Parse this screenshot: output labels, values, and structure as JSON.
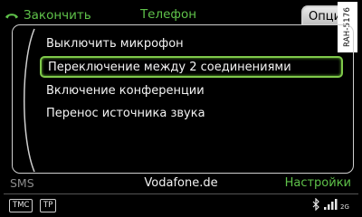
{
  "header": {
    "back_label": "Закончить",
    "title": "Телефон",
    "options_tab": "Опции"
  },
  "watermark": "RAH-5176",
  "menu": {
    "items": [
      {
        "label": "Выключить микрофон",
        "selected": false
      },
      {
        "label": "Переключение между 2 соединениями",
        "selected": true
      },
      {
        "label": "Включение конференции",
        "selected": false
      },
      {
        "label": "Перенос источника звука",
        "selected": false
      }
    ]
  },
  "bottom": {
    "left_label": "SMS",
    "provider": "Vodafone.de",
    "right_label": "Настройки"
  },
  "status": {
    "tmc": "TMC",
    "tp": "TP",
    "network": "2G"
  },
  "colors": {
    "accent_green": "#5fc24a",
    "selection_border": "#7fc94a",
    "background": "#000000"
  },
  "icons": [
    "phone-hangup-icon",
    "bluetooth-icon",
    "signal-strength-icon"
  ]
}
